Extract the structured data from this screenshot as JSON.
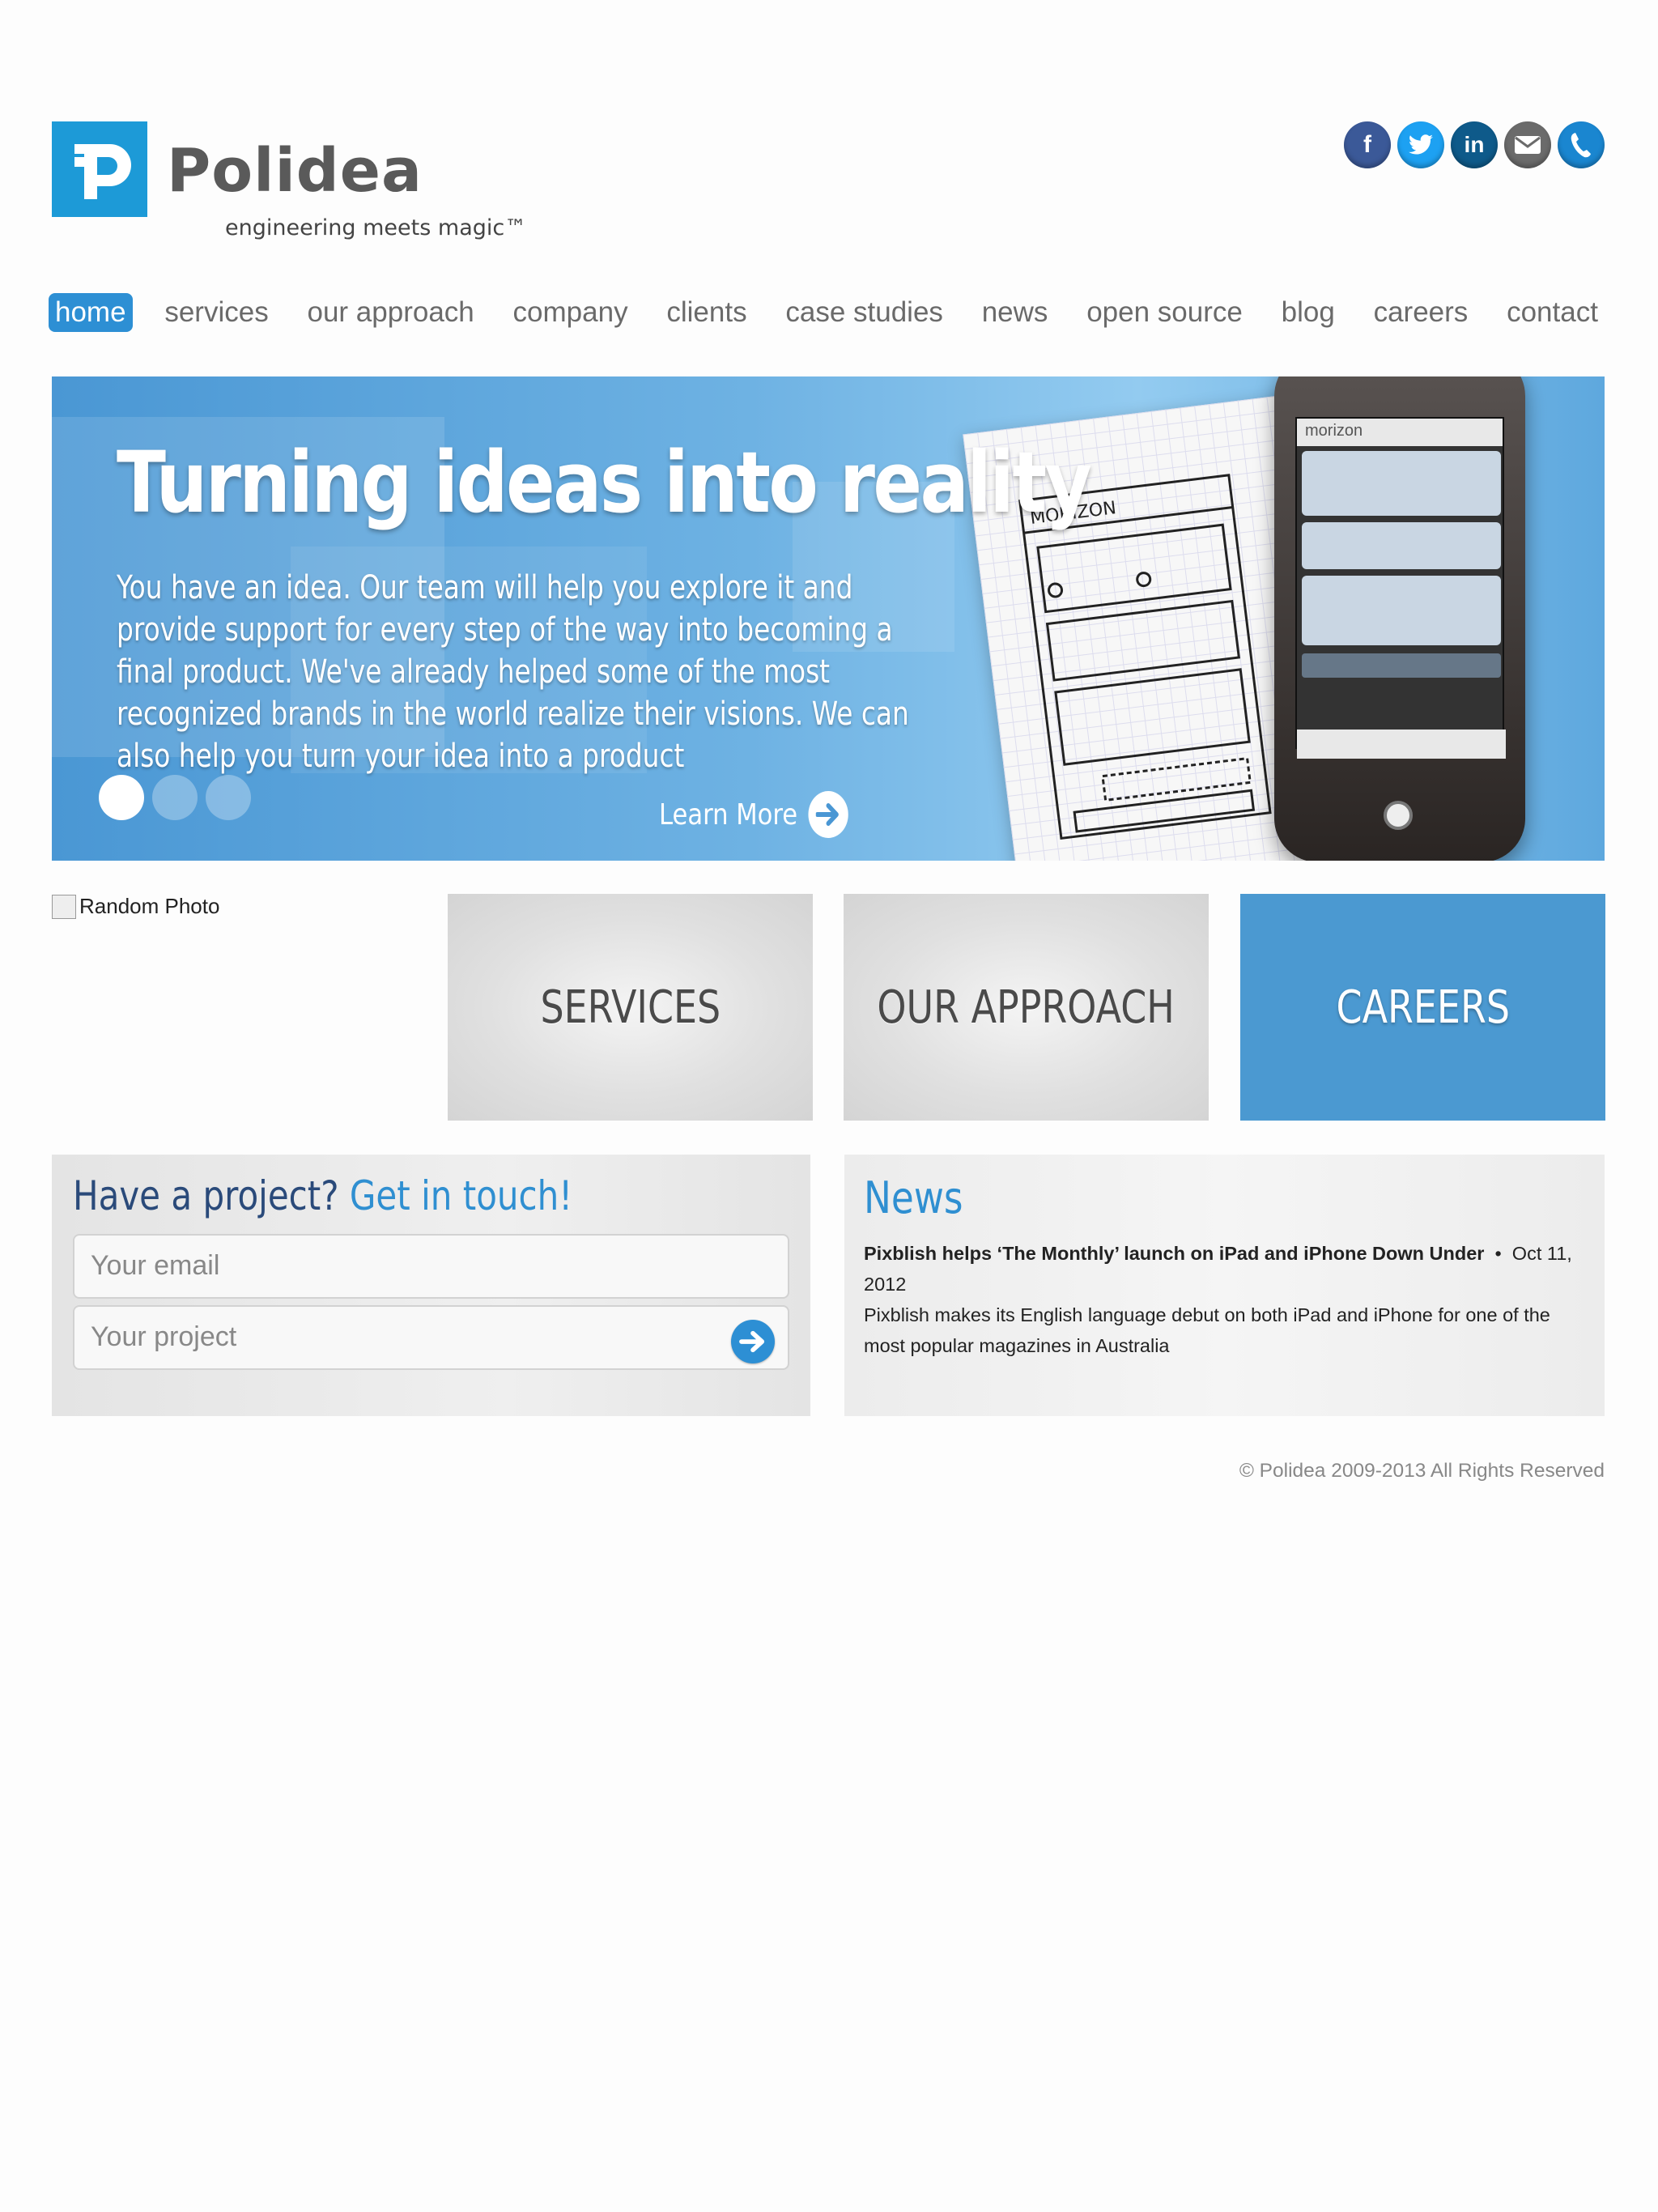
{
  "brand": {
    "name": "Polidea",
    "tagline": "engineering meets magic™",
    "logo_color": "#1d9ad7"
  },
  "social": [
    {
      "name": "facebook-icon",
      "color": "#3b5998",
      "glyph": "f"
    },
    {
      "name": "twitter-icon",
      "color": "#1da1f2",
      "glyph": "t"
    },
    {
      "name": "linkedin-icon",
      "color": "#0e5a8a",
      "glyph": "in"
    },
    {
      "name": "mail-icon",
      "color": "#6b6b6b",
      "glyph": "✉"
    },
    {
      "name": "phone-icon",
      "color": "#1a86d0",
      "glyph": "✆"
    }
  ],
  "nav": {
    "items": [
      "home",
      "services",
      "our approach",
      "company",
      "clients",
      "case studies",
      "news",
      "open source",
      "blog",
      "careers",
      "contact"
    ],
    "active": "home"
  },
  "hero": {
    "title": "Turning ideas into reality",
    "text": "You have an idea. Our team will help you explore it and provide support for every step of the way into becoming a final product. We've already helped some of the most recognized brands in the world realize their visions. We can also help you turn your idea into a product",
    "learn_more": "Learn More",
    "slides": 3,
    "active_slide": 1,
    "phone_app": "morizon"
  },
  "tiles": {
    "photo_alt": "Random Photo",
    "services": "SERVICES",
    "approach": "OUR APPROACH",
    "careers": "CAREERS"
  },
  "contact": {
    "title_a": "Have a project?",
    "title_b": "Get in touch!",
    "email_placeholder": "Your email",
    "project_placeholder": "Your project"
  },
  "news": {
    "title": "News",
    "headline": "Pixblish helps ‘The Monthly’ launch on iPad and iPhone Down Under",
    "date": "Oct 11, 2012",
    "summary": "Pixblish makes its English language debut on both iPad and iPhone for one of the most popular magazines in Australia"
  },
  "footer": "© Polidea 2009-2013 All Rights Reserved",
  "colors": {
    "accent": "#2d8fd4",
    "hero": "#4a97d4"
  }
}
